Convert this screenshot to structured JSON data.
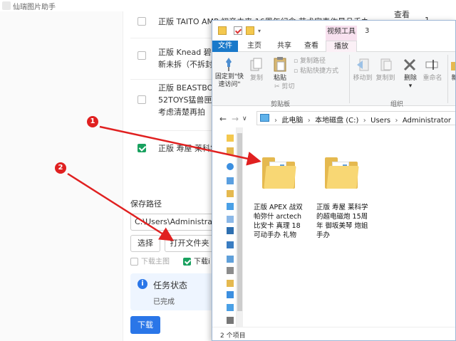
{
  "app": {
    "title": "仙瑞图片助手"
  },
  "list": {
    "header_view": "查看",
    "count_value": "1",
    "items": [
      {
        "text": "正版 TAITO AMP 初音未来 16周年纪念 艺术家表作景品手办",
        "checked": false
      },
      {
        "text_line1": "正版 Knead 碧蓝",
        "text_line2": "新未拆（不拆封可",
        "checked": false
      },
      {
        "text_line1": "正版 BEASTBOX",
        "text_line2": "52TOYS猛兽匣 金",
        "text_line3": "考虑清楚再拍",
        "checked": false
      },
      {
        "text": "正版 寿屋 莱科学",
        "checked": true
      }
    ]
  },
  "save": {
    "label": "保存路径",
    "path_value": "C:\\Users\\Administrato",
    "select_button": "选择",
    "open_folder_button": "打开文件夹"
  },
  "options": {
    "download_main": "下载主图",
    "download_detail": "下载i"
  },
  "task": {
    "title": "任务状态",
    "status": "已完成",
    "icon": "info-icon"
  },
  "download_button": "下载",
  "explorer": {
    "title_context_tab": "视频工具",
    "window_number": "3",
    "tabs": {
      "file": "文件",
      "home": "主页",
      "share": "共享",
      "view": "查看",
      "play": "播放"
    },
    "ribbon": {
      "pin": "固定到\"快\n速访问\"",
      "copy": "复制",
      "paste": "粘贴",
      "copy_path": "复制路径",
      "paste_shortcut": "粘贴快捷方式",
      "cut": "剪切",
      "clipboard_group": "剪贴板",
      "move_to": "移动到",
      "copy_to": "复制到",
      "delete": "删除",
      "rename": "重命名",
      "organize_group": "组织",
      "new": "新"
    },
    "address": {
      "crumbs": [
        "此电脑",
        "本地磁盘 (C:)",
        "Users",
        "Administrator"
      ]
    },
    "folders": [
      {
        "name": "正版 APEX 战双帕弥什 arctech 比安卡 真理 18 可动手办 礼物"
      },
      {
        "name": "正版 寿屋 莱科学的超电磁炮 15周年 御坂美琴 炮姐 手办"
      }
    ],
    "status": "2 个项目"
  },
  "annotations": {
    "marker1": "1",
    "marker2": "2"
  },
  "colors": {
    "accent": "#2a76e8",
    "check": "#19a15f",
    "marker": "#e02020",
    "file_tab": "#1979ca"
  }
}
